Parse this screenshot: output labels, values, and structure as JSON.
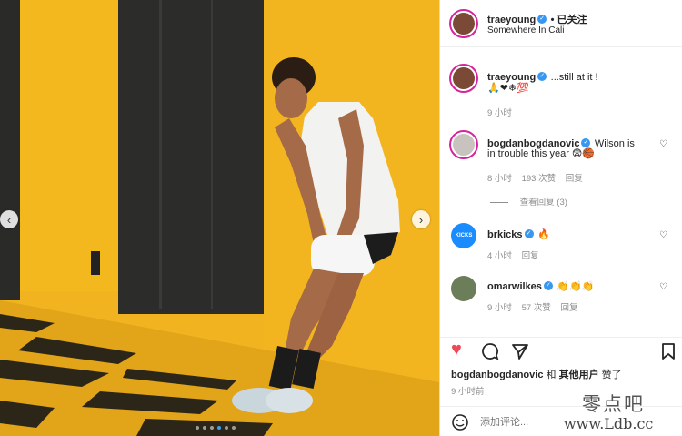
{
  "post": {
    "author": "traeyoung",
    "follow_label": "• 已关注",
    "location": "Somewhere In Cali",
    "caption_user": "traeyoung",
    "caption_text": "...still at it !",
    "caption_emojis": "🙏❤❄💯",
    "caption_time": "9 小时"
  },
  "comments": [
    {
      "user": "bogdanbogdanovic",
      "text_line1": "Wilson is",
      "text_line2": "in trouble this year 😨🏀",
      "time": "8 小时",
      "likes": "193 次赞",
      "reply": "回复",
      "view_replies": "查看回复 (3)"
    },
    {
      "user": "brkicks",
      "text": "🔥",
      "time": "4 小时",
      "reply": "回复",
      "avatar_text": "KICKS"
    },
    {
      "user": "omarwilkes",
      "text": "👏👏👏",
      "time": "9 小时",
      "likes": "57 次赞",
      "reply": "回复"
    }
  ],
  "likes_line": {
    "user": "bogdanbogdanovic",
    "mid": " 和 ",
    "others": "其他用户",
    "suffix": " 赞了"
  },
  "post_time": "9 小时前",
  "add_comment_placeholder": "添加评论...",
  "carousel": {
    "dot_count": 6,
    "active_index": 3
  },
  "watermark": {
    "line1": "零点吧",
    "line2": "www.Ldb.cc"
  },
  "colors": {
    "like_red": "#ed4956",
    "wall_yellow": "#f3b51f",
    "verified_blue": "#3897f0"
  }
}
